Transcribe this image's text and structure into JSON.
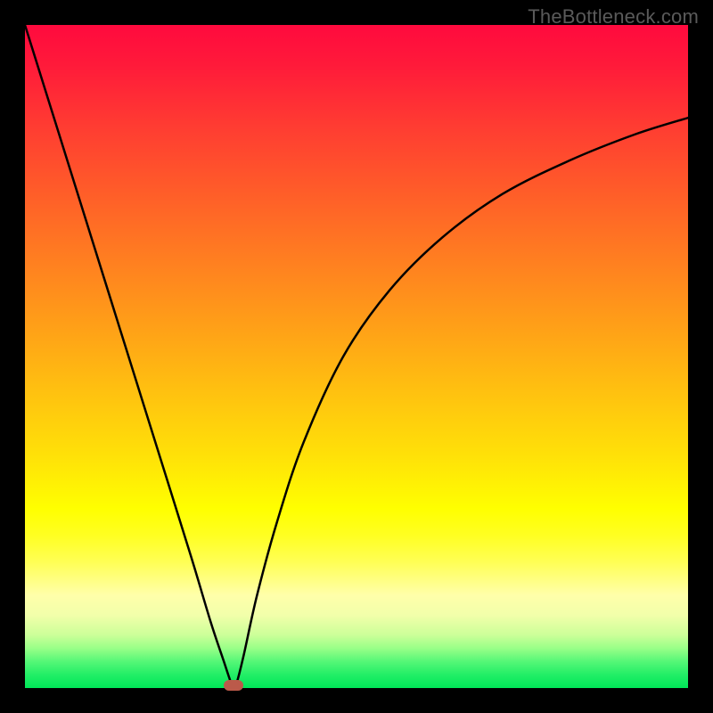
{
  "watermark": "TheBottleneck.com",
  "chart_data": {
    "type": "line",
    "title": "",
    "xlabel": "",
    "ylabel": "",
    "xlim": [
      0,
      100
    ],
    "ylim": [
      0,
      100
    ],
    "grid": false,
    "series": [
      {
        "name": "curve",
        "x": [
          0,
          5,
          10,
          15,
          20,
          25,
          28,
          30,
          31,
          31.5,
          32,
          33,
          35,
          38,
          42,
          48,
          55,
          63,
          72,
          82,
          92,
          100
        ],
        "y": [
          100,
          84,
          68,
          52,
          36,
          20,
          10,
          4,
          1,
          0,
          1,
          5,
          14,
          25,
          37,
          50,
          60,
          68,
          74.5,
          79.5,
          83.5,
          86
        ]
      }
    ],
    "marker": {
      "x": 31.5,
      "y": 0
    },
    "colors": {
      "curve": "#000000",
      "marker": "#bb5a4a",
      "gradient_top": "#ff0a3e",
      "gradient_bottom": "#00e658"
    }
  }
}
